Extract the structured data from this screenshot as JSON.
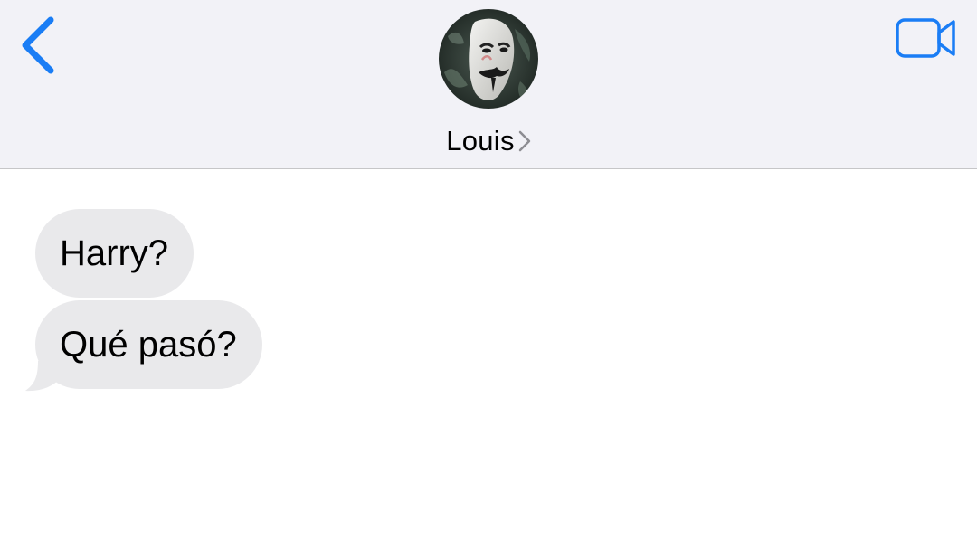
{
  "header": {
    "contact_name": "Louis",
    "back_icon": "chevron-left-icon",
    "video_icon": "video-camera-icon",
    "accent_color": "#1a7df5"
  },
  "messages": [
    {
      "direction": "incoming",
      "text": "Harry?"
    },
    {
      "direction": "incoming",
      "text": "Qué pasó?"
    }
  ]
}
